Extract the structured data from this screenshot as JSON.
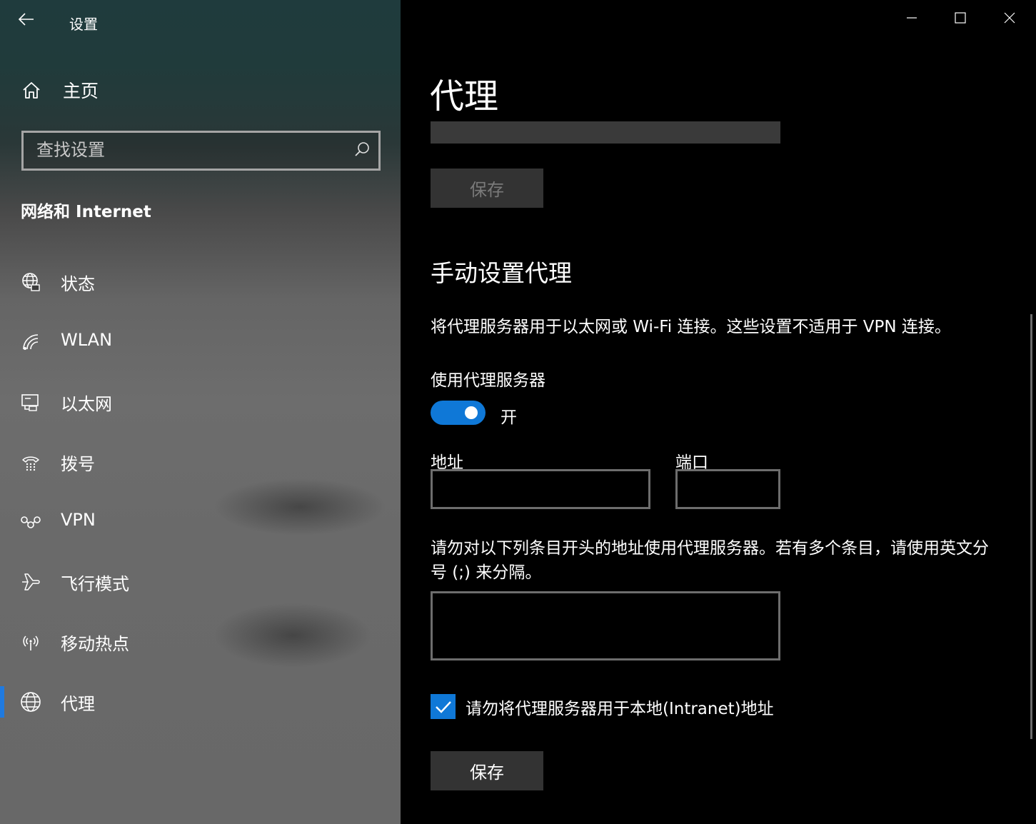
{
  "app": {
    "title": "设置"
  },
  "sidebar": {
    "home_label": "主页",
    "search": {
      "placeholder": "查找设置",
      "value": ""
    },
    "section_title": "网络和 Internet",
    "items": [
      {
        "label": "状态",
        "icon": "globe-status-icon"
      },
      {
        "label": "WLAN",
        "icon": "wifi-icon"
      },
      {
        "label": "以太网",
        "icon": "ethernet-icon"
      },
      {
        "label": "拨号",
        "icon": "dialup-icon"
      },
      {
        "label": "VPN",
        "icon": "vpn-icon"
      },
      {
        "label": "飞行模式",
        "icon": "airplane-icon"
      },
      {
        "label": "移动热点",
        "icon": "hotspot-icon"
      },
      {
        "label": "代理",
        "icon": "globe-icon",
        "selected": true
      }
    ]
  },
  "window_controls": {
    "minimize": "minimize-icon",
    "maximize": "maximize-icon",
    "close": "close-icon"
  },
  "main": {
    "page_title": "代理",
    "save_top_label": "保存",
    "manual_section_title": "手动设置代理",
    "description": "将代理服务器用于以太网或 Wi-Fi 连接。这些设置不适用于 VPN 连接。",
    "use_proxy_label": "使用代理服务器",
    "toggle_state": "开",
    "toggle_on": true,
    "address_label": "地址",
    "address_value": "",
    "port_label": "端口",
    "port_value": "",
    "exceptions_label": "请勿对以下列条目开头的地址使用代理服务器。若有多个条目，请使用英文分号 (;) 来分隔。",
    "exceptions_value": "",
    "local_bypass_label": "请勿将代理服务器用于本地(Intranet)地址",
    "local_bypass_checked": true,
    "save_bottom_label": "保存"
  },
  "colors": {
    "accent": "#0f78d7",
    "background": "#000000",
    "button_bg": "#333333"
  }
}
